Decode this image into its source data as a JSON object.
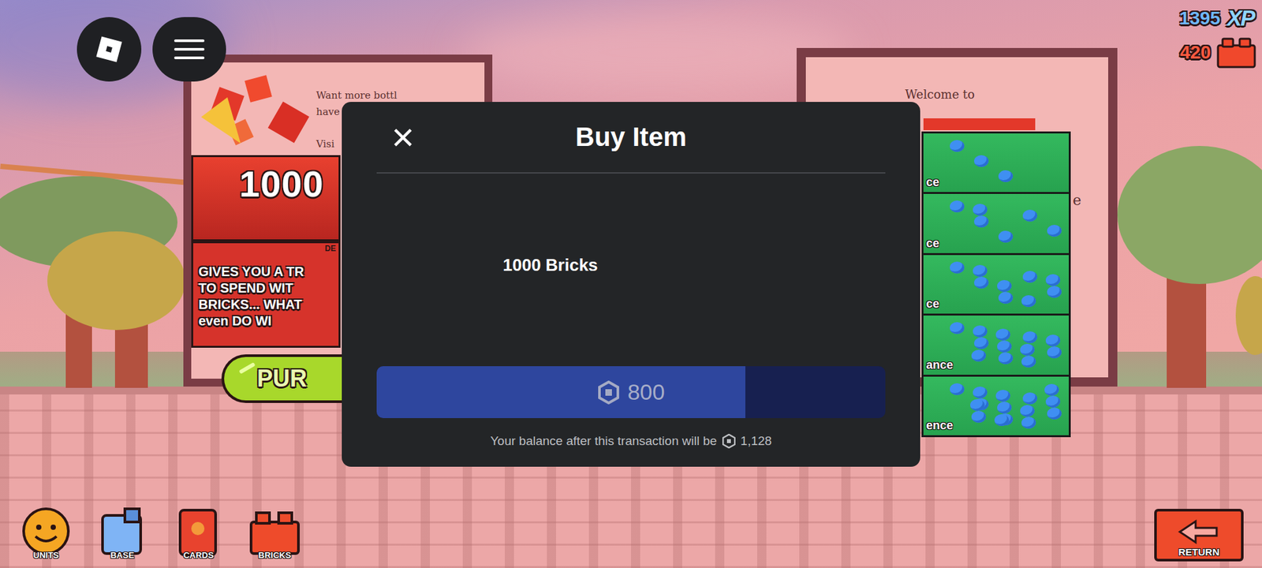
{
  "currencies": [
    {
      "amount": "1395",
      "icon_label": "XP"
    },
    {
      "amount": "420"
    }
  ],
  "scene": {
    "left_board": {
      "lines": [
        "Want more bottl",
        "have",
        "Visi"
      ],
      "card_title": "1000",
      "card_tag": "DE",
      "card_lines": [
        "GIVES YOU A TR",
        "TO SPEND WIT",
        "BRICKS... WHAT",
        "even DO WI"
      ],
      "button": "PUR"
    },
    "right_board": {
      "title": "Welcome to",
      "side_text": "e",
      "rows": [
        "ce",
        "ce",
        "ce",
        "ance",
        "ence"
      ]
    }
  },
  "dialog": {
    "title": "Buy Item",
    "close": "×",
    "item": "1000 Bricks",
    "price": "800",
    "hold_level": 0.725,
    "balance_text": "Your balance after this transaction will be",
    "balance": "1,128"
  },
  "toolbar": [
    {
      "label": "UNITS"
    },
    {
      "label": "BASE"
    },
    {
      "label": "CARDS"
    },
    {
      "label": "BRICKS"
    }
  ],
  "return_button": "RETURN"
}
